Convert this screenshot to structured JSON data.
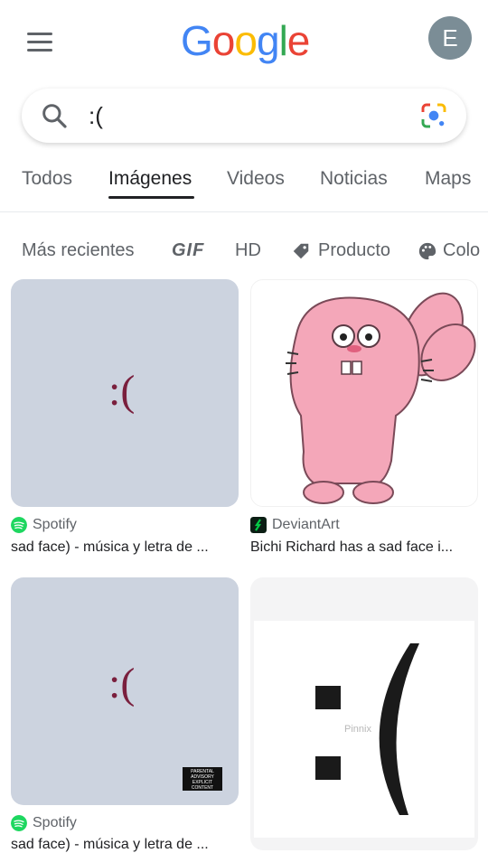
{
  "header": {
    "logo_text": "Google",
    "avatar_letter": "E"
  },
  "search": {
    "query": ":("
  },
  "tabs": [
    {
      "label": "Todos"
    },
    {
      "label": "Imágenes"
    },
    {
      "label": "Videos"
    },
    {
      "label": "Noticias"
    },
    {
      "label": "Maps"
    }
  ],
  "filters": [
    {
      "label": "Más recientes"
    },
    {
      "label": "GIF"
    },
    {
      "label": "HD"
    },
    {
      "label": "Producto"
    },
    {
      "label": "Colo"
    }
  ],
  "results": [
    {
      "source": "Spotify",
      "title": "sad face) - música y letra de ...",
      "image_text": ":("
    },
    {
      "source": "DeviantArt",
      "title": "Bichi Richard has a sad face i..."
    },
    {
      "source": "Spotify",
      "title": "sad face) - música y letra de ...",
      "image_text": ":(",
      "badge": "PARENTAL ADVISORY EXPLICIT CONTENT"
    },
    {
      "image_text": ":(",
      "watermark": "Pinnix"
    }
  ],
  "colors": {
    "spotify": "#1ed760",
    "deviantart": "#05cc47"
  }
}
